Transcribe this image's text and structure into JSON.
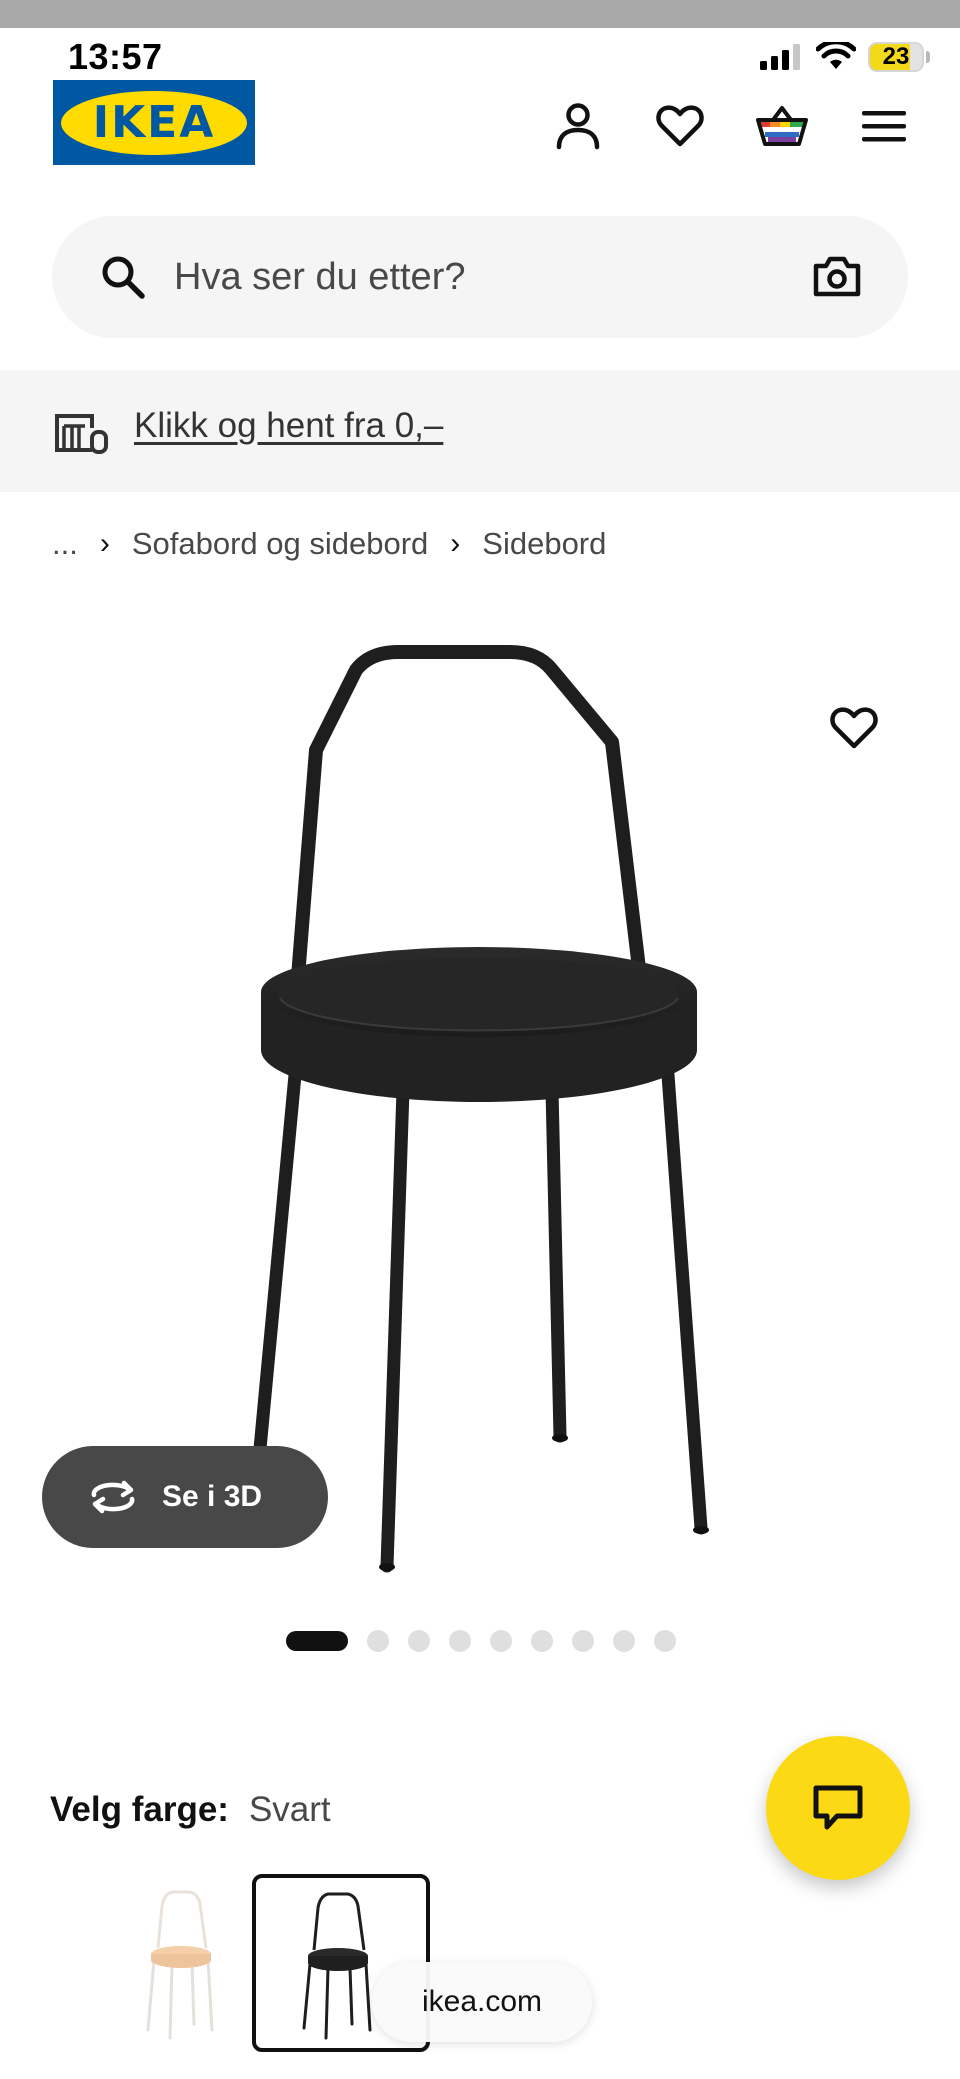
{
  "status_bar": {
    "time": "13:57",
    "battery_level": "23"
  },
  "header": {
    "logo_text": "IKEA",
    "icons": [
      "account-icon",
      "heart-icon",
      "basket-icon",
      "menu-icon"
    ]
  },
  "search": {
    "placeholder": "Hva ser du etter?"
  },
  "banner": {
    "link_text": "Klikk og hent fra 0,–"
  },
  "breadcrumb": {
    "ellipsis": "...",
    "items": [
      "Sofabord og sidebord",
      "Sidebord"
    ]
  },
  "product": {
    "view3d_label": "Se i 3D",
    "carousel": {
      "total": 9,
      "active": 1
    },
    "color_label": "Velg farge:",
    "color_value": "Svart",
    "swatches": [
      "beige",
      "black"
    ],
    "selected_swatch": 1
  },
  "browser": {
    "url": "ikea.com"
  },
  "colors": {
    "brand_blue": "#0058a3",
    "brand_yellow": "#ffdb00",
    "chat_yellow": "#fbd914",
    "table_black": "#222222"
  }
}
